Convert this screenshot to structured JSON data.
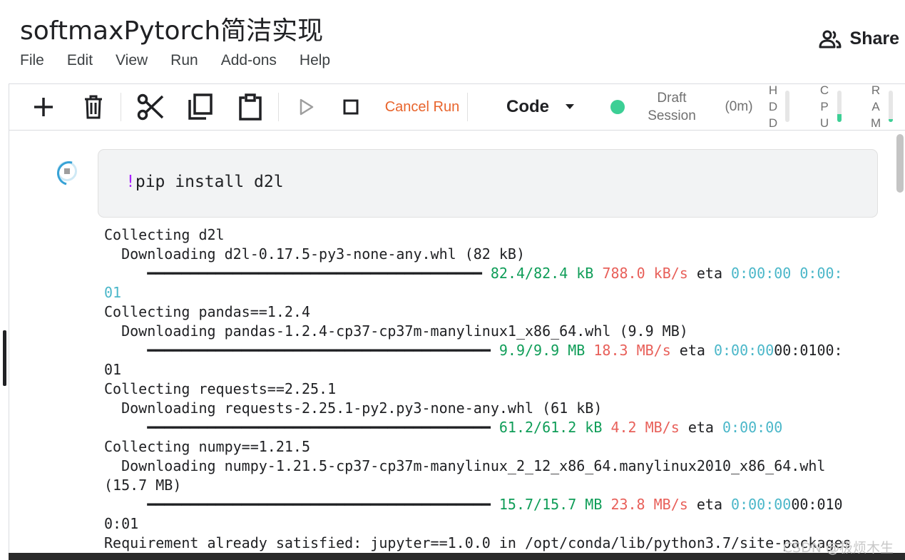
{
  "notebook": {
    "title": "softmaxPytorch简洁实现"
  },
  "menu": [
    "File",
    "Edit",
    "View",
    "Run",
    "Add-ons",
    "Help"
  ],
  "share": {
    "label": "Share",
    "icon": "people-icon"
  },
  "toolbar": {
    "cancel_label": "Cancel Run",
    "cell_type": "Code",
    "session_line1": "Draft",
    "session_line2": "Session",
    "elapsed": "(0m)",
    "session_status_color": "#3ccf95",
    "meters": [
      {
        "label": "HDD",
        "level": 0.0
      },
      {
        "label": "CPU",
        "level": 0.25
      },
      {
        "label": "RAM",
        "level": 0.08
      }
    ]
  },
  "cell": {
    "prefix": "!",
    "code": "pip install d2l",
    "status": "running"
  },
  "output": {
    "line1": "Collecting d2l",
    "line2": "  Downloading d2l-0.17.5-py3-none-any.whl (82 kB)",
    "line3_bar": "     ━━━━━━━━━━━━━━━━━━━━━━━━━━━━━━━━━━━━━━━ ",
    "line3_size": "82.4/82.4 kB",
    "line3_speed": "788.0 kB/s",
    "line3_eta": "eta",
    "line3_time": "0:00:00 0:00:",
    "line4": "01",
    "line5": "Collecting pandas==1.2.4",
    "line6": "  Downloading pandas-1.2.4-cp37-cp37m-manylinux1_x86_64.whl (9.9 MB)",
    "line7_bar": "     ━━━━━━━━━━━━━━━━━━━━━━━━━━━━━━━━━━━━━━━━ ",
    "line7_size": "9.9/9.9 MB",
    "line7_speed": "18.3 MB/s",
    "line7_eta": "eta",
    "line7_time": "0:00:00",
    "line7_tail": "00:0100:",
    "line8": "01",
    "line9": "Collecting requests==2.25.1",
    "line10": "  Downloading requests-2.25.1-py2.py3-none-any.whl (61 kB)",
    "line11_bar": "     ━━━━━━━━━━━━━━━━━━━━━━━━━━━━━━━━━━━━━━━━ ",
    "line11_size": "61.2/61.2 kB",
    "line11_speed": "4.2 MB/s",
    "line11_eta": "eta",
    "line11_time": "0:00:00",
    "line12": "Collecting numpy==1.21.5",
    "line13": "  Downloading numpy-1.21.5-cp37-cp37m-manylinux_2_12_x86_64.manylinux2010_x86_64.whl",
    "line14": "(15.7 MB)",
    "line15_bar": "     ━━━━━━━━━━━━━━━━━━━━━━━━━━━━━━━━━━━━━━━━ ",
    "line15_size": "15.7/15.7 MB",
    "line15_speed": "23.8 MB/s",
    "line15_eta": "eta",
    "line15_time": "0:00:00",
    "line15_tail": "00:010",
    "line16": "0:01",
    "line17": "Requirement already satisfied: jupyter==1.0.0 in /opt/conda/lib/python3.7/site-packages"
  },
  "watermark": "CSDN @极烦木生"
}
